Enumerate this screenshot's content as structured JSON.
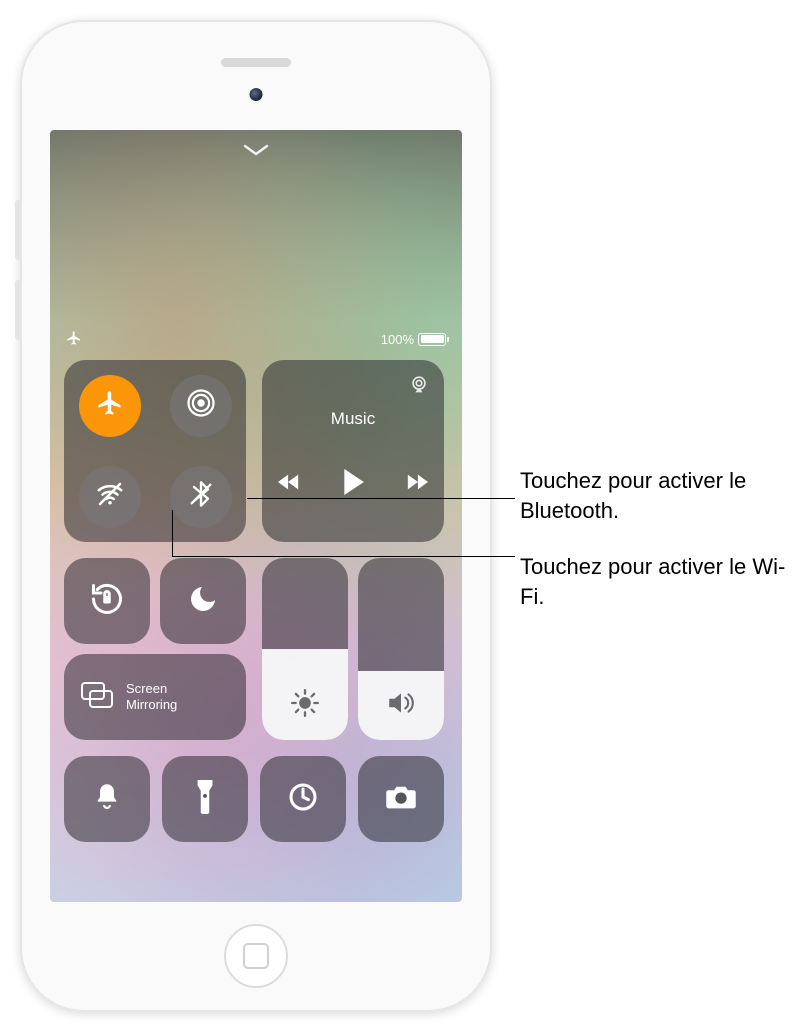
{
  "status": {
    "battery_pct": "100%"
  },
  "music": {
    "title": "Music"
  },
  "mirror": {
    "line1": "Screen",
    "line2": "Mirroring"
  },
  "callouts": {
    "bluetooth": "Touchez pour activer le Bluetooth.",
    "wifi": "Touchez pour activer le Wi-Fi."
  },
  "icons": {
    "airplane": "airplane",
    "airdrop": "airdrop",
    "wifi_off": "wifi-off",
    "bluetooth_off": "bluetooth-off",
    "airplay": "airplay",
    "prev": "prev-track",
    "play": "play",
    "next": "next-track",
    "rotation_lock": "rotation-lock",
    "dnd": "moon",
    "screen_mirror": "screen-mirroring",
    "brightness": "brightness",
    "volume": "volume",
    "bell": "bell",
    "flashlight": "flashlight",
    "timer": "timer",
    "camera": "camera"
  }
}
